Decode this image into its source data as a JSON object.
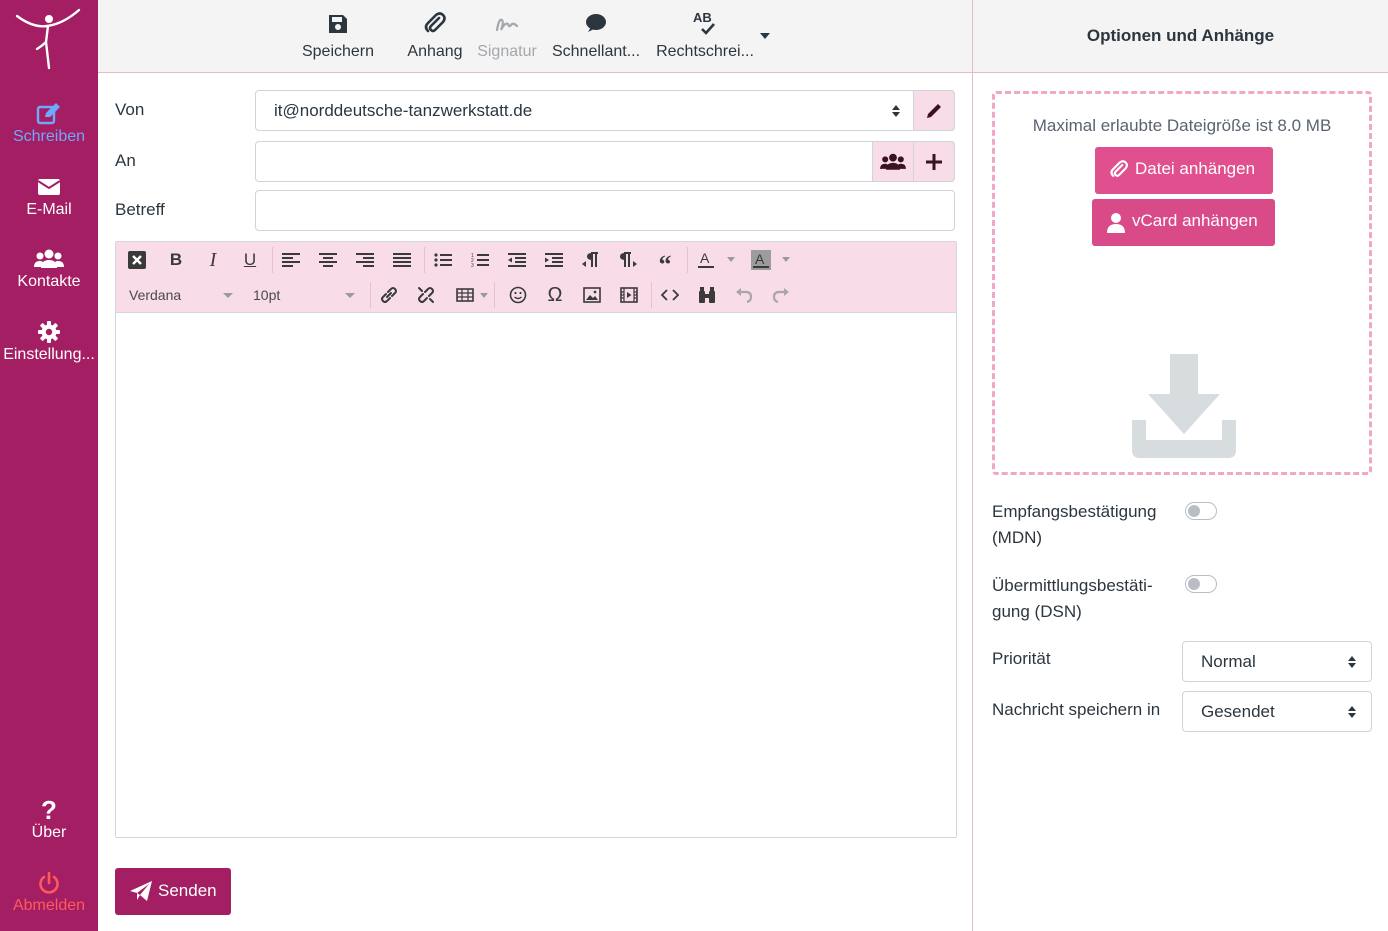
{
  "sidebar": {
    "items": [
      {
        "label": "Schreiben",
        "icon": "edit-icon"
      },
      {
        "label": "E-Mail",
        "icon": "envelope-icon"
      },
      {
        "label": "Kontakte",
        "icon": "users-icon"
      },
      {
        "label": "Einstellung...",
        "icon": "gear-icon"
      }
    ],
    "bottom": [
      {
        "label": "Über",
        "icon": "question-icon"
      },
      {
        "label": "Abmelden",
        "icon": "power-icon"
      }
    ]
  },
  "toolbar": {
    "save": "Speichern",
    "attach": "Anhang",
    "signature": "Signatur",
    "quick_reply": "Schnellant...",
    "spellcheck": "Rechtschrei...",
    "spellcheck_icon_text": "AB"
  },
  "form": {
    "from_label": "Von",
    "from_value": "it@norddeutsche-tanzwerkstatt.de",
    "to_label": "An",
    "to_value": "",
    "subject_label": "Betreff",
    "subject_value": ""
  },
  "editor": {
    "font_family": "Verdana",
    "font_size": "10pt"
  },
  "send_label": "Senden",
  "side": {
    "title": "Optionen und Anhänge",
    "max_size_hint": "Maximal erlaubte Dateigröße ist 8.0 MB",
    "attach_file": "Datei anhängen",
    "attach_vcard": "vCard anhängen",
    "mdn_label": "Empfangsbestätigung (MDN)",
    "dsn_label": "Übermittlungsbestäti-gung (DSN)",
    "priority_label": "Priorität",
    "priority_value": "Normal",
    "save_in_label": "Nachricht speichern in",
    "save_in_value": "Gesendet"
  },
  "colors": {
    "brand": "#a41e63",
    "accent_pink": "#e0508e",
    "toolbar_pink": "#f8dde9",
    "active_nav": "#6fa8ff",
    "logout": "#ff5a5a"
  }
}
